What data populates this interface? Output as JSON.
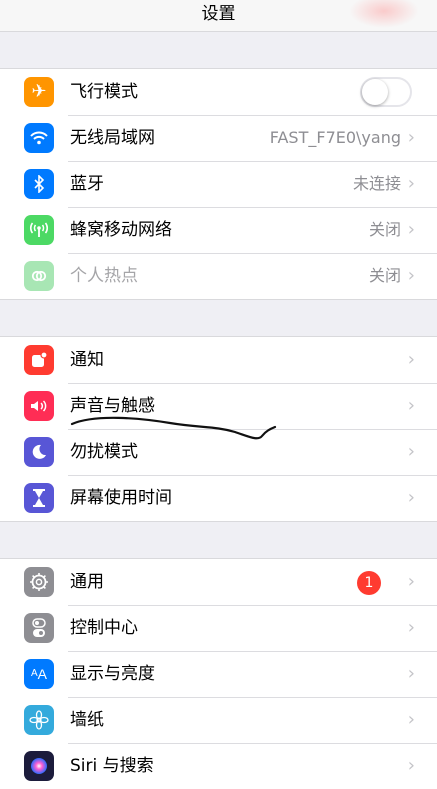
{
  "nav": {
    "title": "设置"
  },
  "group1": [
    {
      "name": "airplane",
      "label": "飞行模式",
      "icon_color": "#ff9500",
      "icon": "airplane-icon",
      "glyph": "✈",
      "toggle": false
    },
    {
      "name": "wlan",
      "label": "无线局域网",
      "value": "FAST_F7E0\\yang",
      "icon_color": "#007aff",
      "icon": "wifi-icon",
      "glyph": ""
    },
    {
      "name": "bluetooth",
      "label": "蓝牙",
      "value": "未连接",
      "icon_color": "#007aff",
      "icon": "bluetooth-icon",
      "glyph": "ᛒ"
    },
    {
      "name": "cellular",
      "label": "蜂窝移动网络",
      "value": "关闭",
      "icon_color": "#4cd964",
      "icon": "cellular-antenna-icon",
      "glyph": ""
    },
    {
      "name": "hotspot",
      "label": "个人热点",
      "value": "关闭",
      "icon_color": "#a8e6b4",
      "icon": "hotspot-icon",
      "glyph": "",
      "disabled": true
    }
  ],
  "group2": [
    {
      "name": "notifications",
      "label": "通知",
      "icon_color": "#ff3b30",
      "icon": "notifications-icon"
    },
    {
      "name": "sounds",
      "label": "声音与触感",
      "icon_color": "#ff2d55",
      "icon": "speaker-icon"
    },
    {
      "name": "dnd",
      "label": "勿扰模式",
      "icon_color": "#5856d6",
      "icon": "moon-icon"
    },
    {
      "name": "screentime",
      "label": "屏幕使用时间",
      "icon_color": "#5856d6",
      "icon": "hourglass-icon"
    }
  ],
  "group3": [
    {
      "name": "general",
      "label": "通用",
      "badge": "1",
      "icon_color": "#8e8e93",
      "icon": "gear-icon"
    },
    {
      "name": "control-center",
      "label": "控制中心",
      "icon_color": "#8e8e93",
      "icon": "switches-icon"
    },
    {
      "name": "display",
      "label": "显示与亮度",
      "icon_color": "#007aff",
      "icon": "text-size-icon",
      "glyph": "AA"
    },
    {
      "name": "wallpaper",
      "label": "墙纸",
      "icon_color": "#34aadc",
      "icon": "flower-icon"
    },
    {
      "name": "siri",
      "label": "Siri 与搜索",
      "icon_color": "#1c1c3c",
      "icon": "siri-icon"
    }
  ],
  "chevron": "›"
}
